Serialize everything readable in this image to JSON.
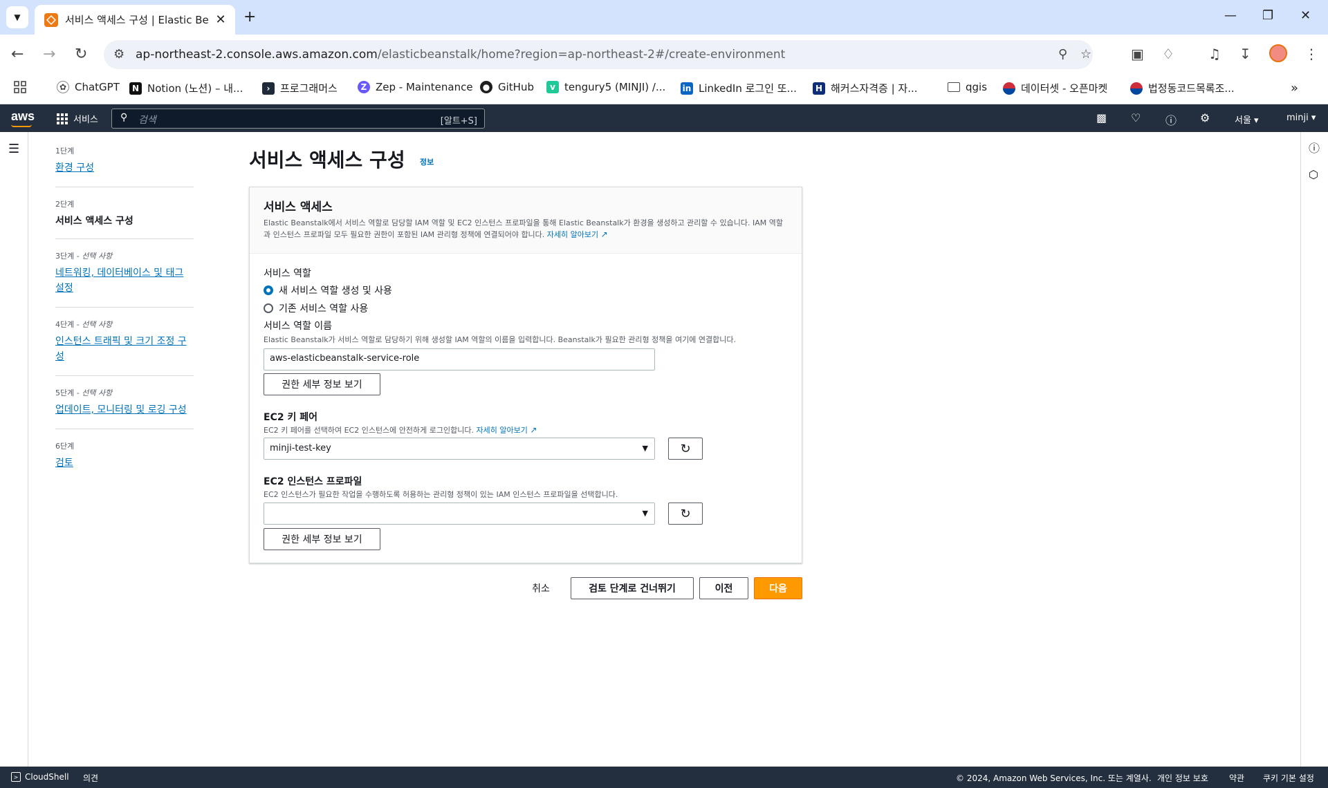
{
  "browser": {
    "tab_title": "서비스 액세스 구성 | Elastic Be",
    "url_host": "ap-northeast-2.console.aws.amazon.com",
    "url_path": "/elasticbeanstalk/home?region=ap-northeast-2#/create-environment",
    "bookmarks": [
      {
        "label": "ChatGPT",
        "icon": "chatgpt-icon"
      },
      {
        "label": "Notion (노션) – 내...",
        "icon": "notion-icon"
      },
      {
        "label": "프로그래머스",
        "icon": "programmers-icon"
      },
      {
        "label": "Zep - Maintenance",
        "icon": "zep-icon"
      },
      {
        "label": "GitHub",
        "icon": "github-icon"
      },
      {
        "label": "tengury5 (MINJI) /...",
        "icon": "velog-icon"
      },
      {
        "label": "LinkedIn 로그인 또...",
        "icon": "linkedin-icon"
      },
      {
        "label": "해커스자격증 | 자...",
        "icon": "hackers-icon"
      },
      {
        "label": "qgis",
        "icon": "folder-icon"
      },
      {
        "label": "데이터셋 - 오픈마켓",
        "icon": "korea-gov-icon"
      },
      {
        "label": "법정동코드목록조...",
        "icon": "korea-gov-icon"
      }
    ]
  },
  "aws_nav": {
    "logo": "aws",
    "services": "서비스",
    "search_placeholder": "검색",
    "search_shortcut": "[알트+S]",
    "region": "서울 ▾",
    "user": "minji ▾"
  },
  "steps": [
    {
      "num": "1단계",
      "optional": "",
      "label": "환경 구성",
      "current": false
    },
    {
      "num": "2단계",
      "optional": "",
      "label": "서비스 액세스 구성",
      "current": true
    },
    {
      "num": "3단계",
      "optional": " - 선택 사항",
      "label": "네트워킹, 데이터베이스 및 태그 설정",
      "current": false
    },
    {
      "num": "4단계",
      "optional": " - 선택 사항",
      "label": "인스턴스 트래픽 및 크기 조정 구성",
      "current": false
    },
    {
      "num": "5단계",
      "optional": " - 선택 사항",
      "label": "업데이트, 모니터링 및 로깅 구성",
      "current": false
    },
    {
      "num": "6단계",
      "optional": "",
      "label": "검토",
      "current": false
    }
  ],
  "page": {
    "title": "서비스 액세스 구성",
    "info": "정보"
  },
  "panel": {
    "title": "서비스 액세스",
    "desc": "Elastic Beanstalk에서 서비스 역할로 담당할 IAM 역할 및 EC2 인스턴스 프로파일을 통해 Elastic Beanstalk가 환경을 생성하고 관리할 수 있습니다. IAM 역할과 인스턴스 프로파일 모두 필요한 권한이 포함된 IAM 관리형 정책에 연결되어야 합니다.",
    "learn_more": "자세히 알아보기",
    "service_role_label": "서비스 역할",
    "radio_new": "새 서비스 역할 생성 및 사용",
    "radio_existing": "기존 서비스 역할 사용",
    "role_name_label": "서비스 역할 이름",
    "role_name_hint": "Elastic Beanstalk가 서비스 역할로 담당하기 위해 생성할 IAM 역할의 이름을 입력합니다. Beanstalk가 필요한 관리형 정책을 여기에 연결합니다.",
    "role_name_value": "aws-elasticbeanstalk-service-role",
    "view_permissions": "권한 세부 정보 보기",
    "keypair_label": "EC2 키 페어",
    "keypair_hint": "EC2 키 페어를 선택하여 EC2 인스턴스에 안전하게 로그인합니다.",
    "keypair_learn_more": "자세히 알아보기",
    "keypair_value": "minji-test-key",
    "profile_label": "EC2 인스턴스 프로파일",
    "profile_hint": "EC2 인스턴스가 필요한 작업을 수행하도록 허용하는 관리형 정책이 있는 IAM 인스턴스 프로파일을 선택합니다.",
    "profile_value": "",
    "view_permissions_2": "권한 세부 정보 보기"
  },
  "actions": {
    "cancel": "취소",
    "skip": "검토 단계로 건너뛰기",
    "prev": "이전",
    "next": "다음"
  },
  "footer": {
    "cloudshell": "CloudShell",
    "feedback": "의견",
    "copyright": "© 2024, Amazon Web Services, Inc. 또는 계열사.",
    "privacy": "개인 정보 보호",
    "terms": "약관",
    "cookies": "쿠키 기본 설정"
  },
  "colors": {
    "aws_nav": "#232f3e",
    "link": "#0073bb",
    "primary": "#ff9900"
  }
}
